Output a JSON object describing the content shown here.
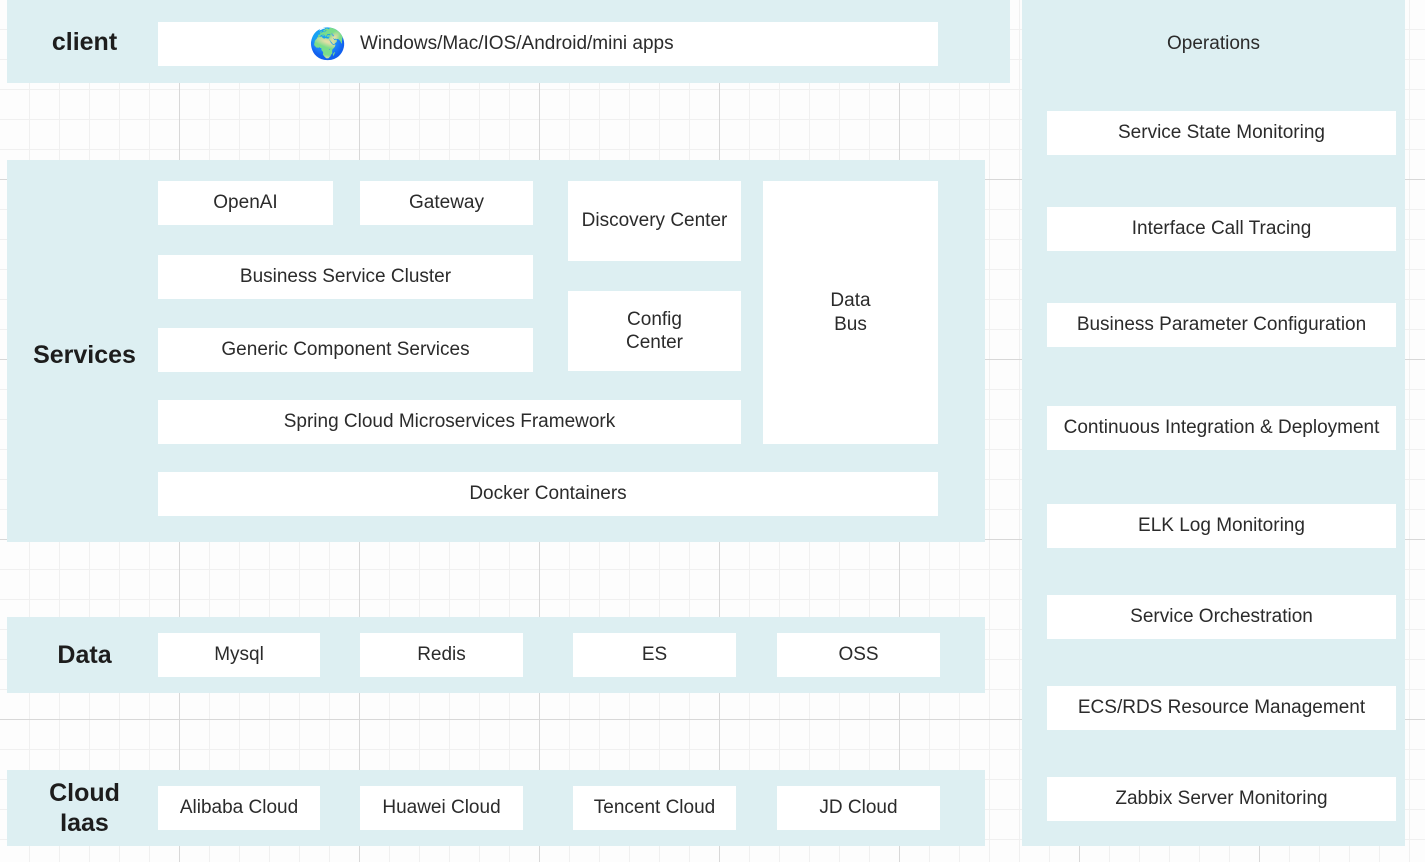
{
  "theme": {
    "panel_bg": "#ddeff2",
    "box_bg": "#ffffff",
    "text": "#2b2b2b",
    "label_text": "#1d1d1d",
    "grid_major": "#d8d8d8",
    "grid_minor": "#f0f0f0",
    "canvas_bg": "#fdfdfd"
  },
  "client_layer": {
    "label": "client",
    "icon": "globe-icon",
    "icon_glyph": "🌍",
    "box_label": "Windows/Mac/IOS/Android/mini apps"
  },
  "services_layer": {
    "label": "Services",
    "boxes": [
      {
        "label": "OpenAI"
      },
      {
        "label": "Gateway"
      },
      {
        "label": "Business Service Cluster"
      },
      {
        "label": "Generic Component Services"
      },
      {
        "label": "Discovery Center"
      },
      {
        "label": "Config\nCenter"
      },
      {
        "label": "Data\nBus"
      },
      {
        "label": "Spring Cloud Microservices Framework"
      },
      {
        "label": "Docker Containers"
      }
    ]
  },
  "data_layer": {
    "label": "Data",
    "boxes": [
      {
        "label": "Mysql"
      },
      {
        "label": "Redis"
      },
      {
        "label": "ES"
      },
      {
        "label": "OSS"
      }
    ]
  },
  "cloud_layer": {
    "label": "Cloud\nIaas",
    "boxes": [
      {
        "label": "Alibaba Cloud"
      },
      {
        "label": "Huawei Cloud"
      },
      {
        "label": "Tencent Cloud"
      },
      {
        "label": "JD Cloud"
      }
    ]
  },
  "operations_panel": {
    "title": "Operations",
    "items": [
      {
        "label": "Service State Monitoring"
      },
      {
        "label": "Interface Call Tracing"
      },
      {
        "label": "Business Parameter Configuration"
      },
      {
        "label": "Continuous Integration & Deployment"
      },
      {
        "label": "ELK Log Monitoring"
      },
      {
        "label": "Service Orchestration"
      },
      {
        "label": "ECS/RDS Resource Management"
      },
      {
        "label": "Zabbix Server Monitoring"
      }
    ]
  }
}
